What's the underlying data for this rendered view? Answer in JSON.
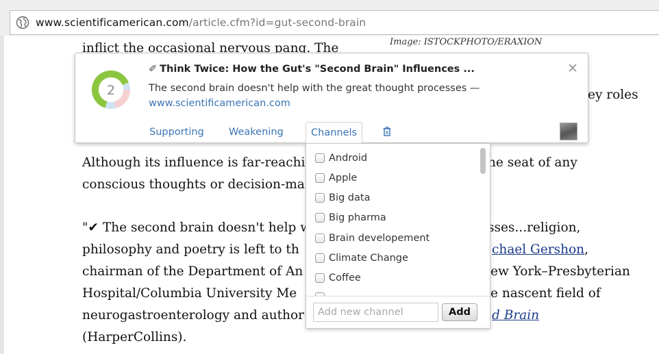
{
  "browser": {
    "url_domain": "www.scientificamerican.com",
    "url_path": "/article.cfm?id=gut-second-brain"
  },
  "article": {
    "image_credit": "Image: ISTOCKPHOTO/ERAXION",
    "top_fragment": "inflict the occasional nervous pang. The",
    "right_fragment": "ey roles",
    "p1_line1": "Although its influence is far-reachi",
    "p1_line1_right": "he seat of any",
    "p1_line2": "conscious thoughts or decision-ma",
    "p2_line1": "\"✔ The second brain doesn't help w",
    "p2_line1_right": "sses...religion,",
    "p2_line2": "philosophy and poetry is left to th",
    "p2_line2_link": "chael Gershon",
    "p2_line2_tail": ",",
    "p2_line3": "chairman of the Department of An",
    "p2_line3_right": "ew York–Presbyterian",
    "p2_line4": "Hospital/Columbia University Me",
    "p2_line4_right": "e nascent field of",
    "p2_line5": "neurogastroenterology and author",
    "p2_line5_link": "d Brain",
    "p2_line6": "(HarperCollins)."
  },
  "card": {
    "count": "2",
    "pencil": "✐",
    "title": "Think Twice: How the Gut's \"Second Brain\" Influences ...",
    "quote": "The second brain doesn't help with the great thought processes —",
    "site": "www.scientificamerican.com",
    "close": "✕",
    "tabs": {
      "supporting": "Supporting",
      "weakening": "Weakening",
      "channels": "Channels"
    }
  },
  "channels": {
    "options": [
      "Android",
      "Apple",
      "Big data",
      "Big pharma",
      "Brain developement",
      "Climate Change",
      "Coffee"
    ],
    "new_placeholder": "Add new channel",
    "add_label": "Add"
  },
  "colors": {
    "link": "#3a74b4",
    "donut_green": "#8cc63f",
    "donut_blue": "#cfe3f2",
    "donut_pink": "#f6d0d0"
  }
}
